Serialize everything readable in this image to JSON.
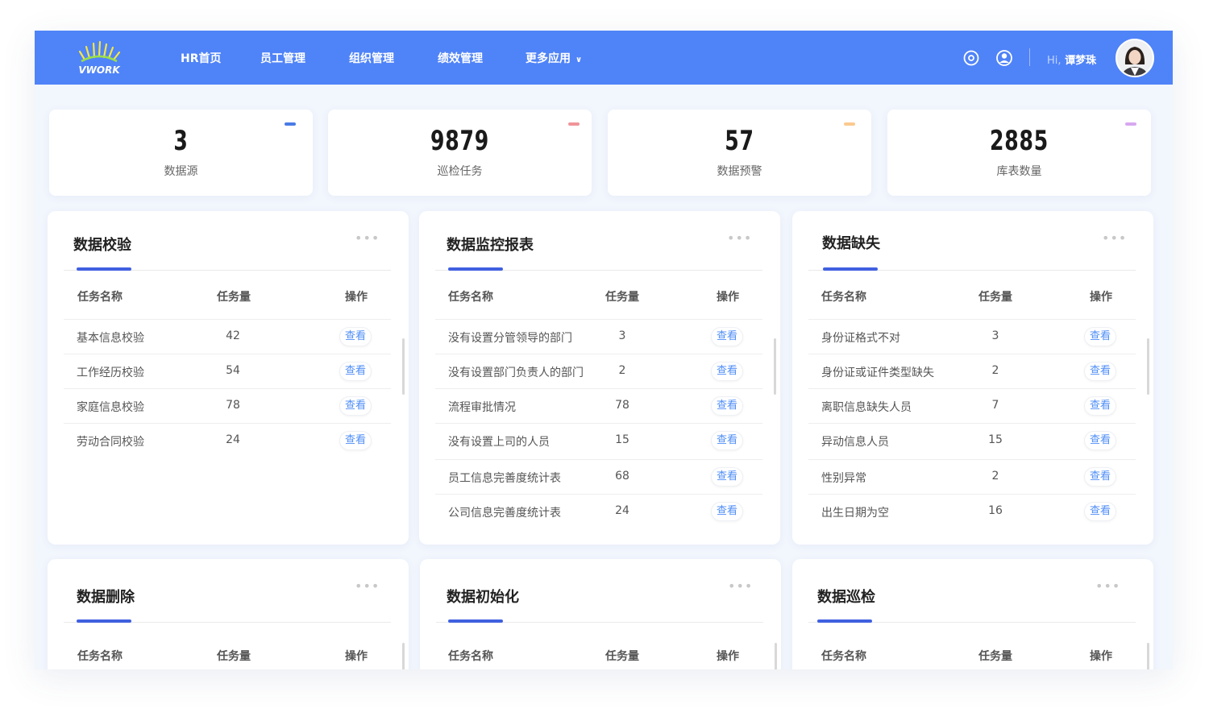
{
  "header": {
    "logo_text": "VWORK",
    "nav": [
      "HR首页",
      "员工管理",
      "组织管理",
      "绩效管理",
      "更多应用"
    ],
    "greeting_hi": "Hi,",
    "user_name": "谭梦珠",
    "brand_color": "#4f83f8",
    "icons": [
      "settings-icon",
      "user-icon",
      "chevron-down-icon"
    ]
  },
  "stats": [
    {
      "value": "3",
      "label": "数据源",
      "accent": "#4a7be6"
    },
    {
      "value": "9879",
      "label": "巡检任务",
      "accent": "#f0959a"
    },
    {
      "value": "57",
      "label": "数据预警",
      "accent": "#fbc98f"
    },
    {
      "value": "2885",
      "label": "库表数量",
      "accent": "#d7a8f0"
    }
  ],
  "table_headers": {
    "name": "任务名称",
    "count": "任务量",
    "action": "操作"
  },
  "view_label": "查看",
  "more_label": "•••",
  "cards": [
    {
      "title": "数据校验",
      "rows": [
        {
          "name": "基本信息校验",
          "count": "42"
        },
        {
          "name": "工作经历校验",
          "count": "54"
        },
        {
          "name": "家庭信息校验",
          "count": "78"
        },
        {
          "name": "劳动合同校验",
          "count": "24"
        }
      ]
    },
    {
      "title": "数据监控报表",
      "rows": [
        {
          "name": "没有设置分管领导的部门",
          "count": "3"
        },
        {
          "name": "没有设置部门负责人的部门",
          "count": "2"
        },
        {
          "name": "流程审批情况",
          "count": "78"
        },
        {
          "name": "没有设置上司的人员",
          "count": "15"
        },
        {
          "name": "员工信息完善度统计表",
          "count": "68"
        },
        {
          "name": "公司信息完善度统计表",
          "count": "24"
        }
      ]
    },
    {
      "title": "数据缺失",
      "rows": [
        {
          "name": "身份证格式不对",
          "count": "3"
        },
        {
          "name": "身份证或证件类型缺失",
          "count": "2"
        },
        {
          "name": "离职信息缺失人员",
          "count": "7"
        },
        {
          "name": "异动信息人员",
          "count": "15"
        },
        {
          "name": "性别异常",
          "count": "2"
        },
        {
          "name": "出生日期为空",
          "count": "16"
        }
      ]
    },
    {
      "title": "数据删除",
      "rows": []
    },
    {
      "title": "数据初始化",
      "rows": []
    },
    {
      "title": "数据巡检",
      "rows": []
    }
  ]
}
